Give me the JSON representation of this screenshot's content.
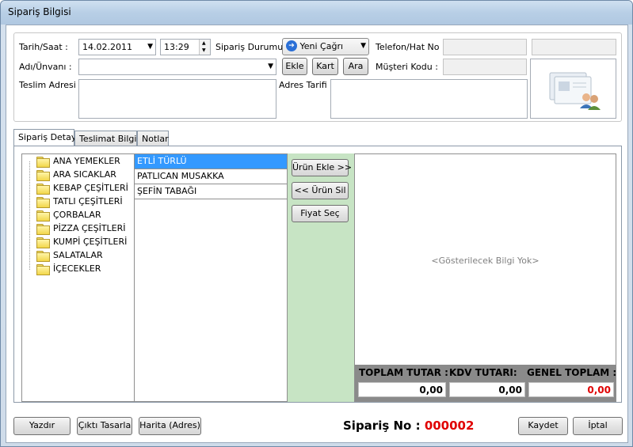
{
  "window": {
    "title": "Sipariş Bilgisi"
  },
  "header": {
    "date_label": "Tarih/Saat :",
    "date_value": "14.02.2011",
    "time_value": "13:29",
    "status_label": "Sipariş Durumu :",
    "status_value": "Yeni Çağrı",
    "phone_label": "Telefon/Hat No :",
    "phone_value": "",
    "phone_extra": "",
    "name_label": "Adı/Ünvanı :",
    "name_value": "",
    "add_button": "Ekle",
    "find_button": "Kart",
    "search_button": "Ara",
    "customer_code_label": "Müşteri Kodu :",
    "customer_code_value": "",
    "address_label": "Teslim Adresi :",
    "address_value": "",
    "directions_label": "Adres Tarifi :",
    "directions_value": ""
  },
  "tabs": [
    {
      "label": "Sipariş Detay",
      "active": true
    },
    {
      "label": "Teslimat Bilgisi",
      "active": false
    },
    {
      "label": "Notlar",
      "active": false
    }
  ],
  "categories": [
    "ANA YEMEKLER",
    "ARA SICAKLAR",
    "KEBAP ÇEŞİTLERİ",
    "TATLI ÇEŞİTLERİ",
    "ÇORBALAR",
    "PİZZA ÇEŞİTLERİ",
    "KUMPİ ÇEŞİTLERİ",
    "SALATALAR",
    "İÇECEKLER"
  ],
  "products": [
    {
      "name": "ETLİ TÜRLÜ",
      "selected": true
    },
    {
      "name": "PATLICAN MUSAKKA",
      "selected": false
    },
    {
      "name": "ŞEFİN TABAĞI",
      "selected": false
    }
  ],
  "actions": {
    "add_product": "Ürün Ekle >>",
    "remove_product": "<< Ürün Sil",
    "select_price": "Fiyat Seç"
  },
  "order_grid": {
    "empty_text": "<Gösterilecek Bilgi Yok>"
  },
  "totals": {
    "total_label": "TOPLAM TUTAR :",
    "total_value": "0,00",
    "vat_label": "KDV TUTARI:",
    "vat_value": "0,00",
    "grand_label": "GENEL TOPLAM :",
    "grand_value": "0,00",
    "grand_color": "#e00000"
  },
  "footer": {
    "print_button": "Yazdır",
    "design_button": "Çıktı Tasarla",
    "map_button": "Harita (Adres)",
    "order_no_label": "Sipariş No :",
    "order_no_value": "000002",
    "save_button": "Kaydet",
    "cancel_button": "İptal"
  }
}
